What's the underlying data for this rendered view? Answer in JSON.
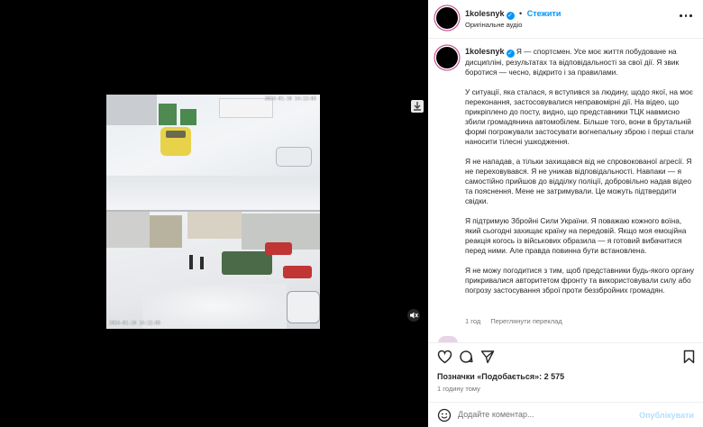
{
  "post": {
    "username": "1kolesnyk",
    "follow_label": "Стежити",
    "audio": "Оригінальне аудіо",
    "more_options": "more-options"
  },
  "media": {
    "cam1_timestamp": "2024-01-10 14:12:05",
    "cam2_timestamp": "2024-01-10 14:12:05"
  },
  "caption": {
    "username": "1kolesnyk",
    "intro": "Я — спортсмен. Усе моє життя побудоване на дисципліні, результатах та відповідальності за свої дії. Я звик боротися — чесно, відкрито і за правилами.",
    "p2": "У ситуації, яка сталася, я вступився за людину, щодо якої, на моє переконання, застосовувалися неправомірні дії. На відео, що прикріплено до посту, видно, що представники ТЦК навмисно збили громадянина автомобілем. Більше того, вони в брутальній формі погрожували застосувати вогнепальну зброю і перші стали наносити тілесні ушкодження.",
    "p3": "Я не нападав, а тільки захищався від не спровокованої агресії. Я не переховувався. Я не уникав відповідальності. Навпаки — я самостійно прийшов до відділку поліції, добровільно надав відео та пояснення. Мене не затримували. Це можуть підтвердити свідки.",
    "p4": "Я підтримую Збройні Сили України. Я поважаю кожного воїна, який сьогодні захищає країну на передовій. Якщо моя емоційна реакція когось із військових образила — я готовий вибачитися перед ними. Але правда повинна бути встановлена.",
    "p5": "Я не можу погодитися з тим, щоб представники будь-якого органу прикривалися авторитетом фронту та використовували силу або погрозу застосування зброї проти беззбройних громадян.",
    "time": "1 год",
    "translate": "Переглянути переклад"
  },
  "actions": {
    "likes": "Позначки «Подобається»: 2 575",
    "ago": "1 годину тому",
    "comment_placeholder": "Додайте коментар...",
    "publish": "Опублікувати"
  },
  "colors": {
    "accent": "#0095f6",
    "text": "#262626",
    "secondary": "#737373",
    "publish_disabled": "#b2dffc"
  },
  "icons": [
    "download-icon",
    "mute-icon",
    "verified-icon",
    "more-icon",
    "heart-icon",
    "comment-icon",
    "share-icon",
    "bookmark-icon",
    "emoji-icon"
  ]
}
